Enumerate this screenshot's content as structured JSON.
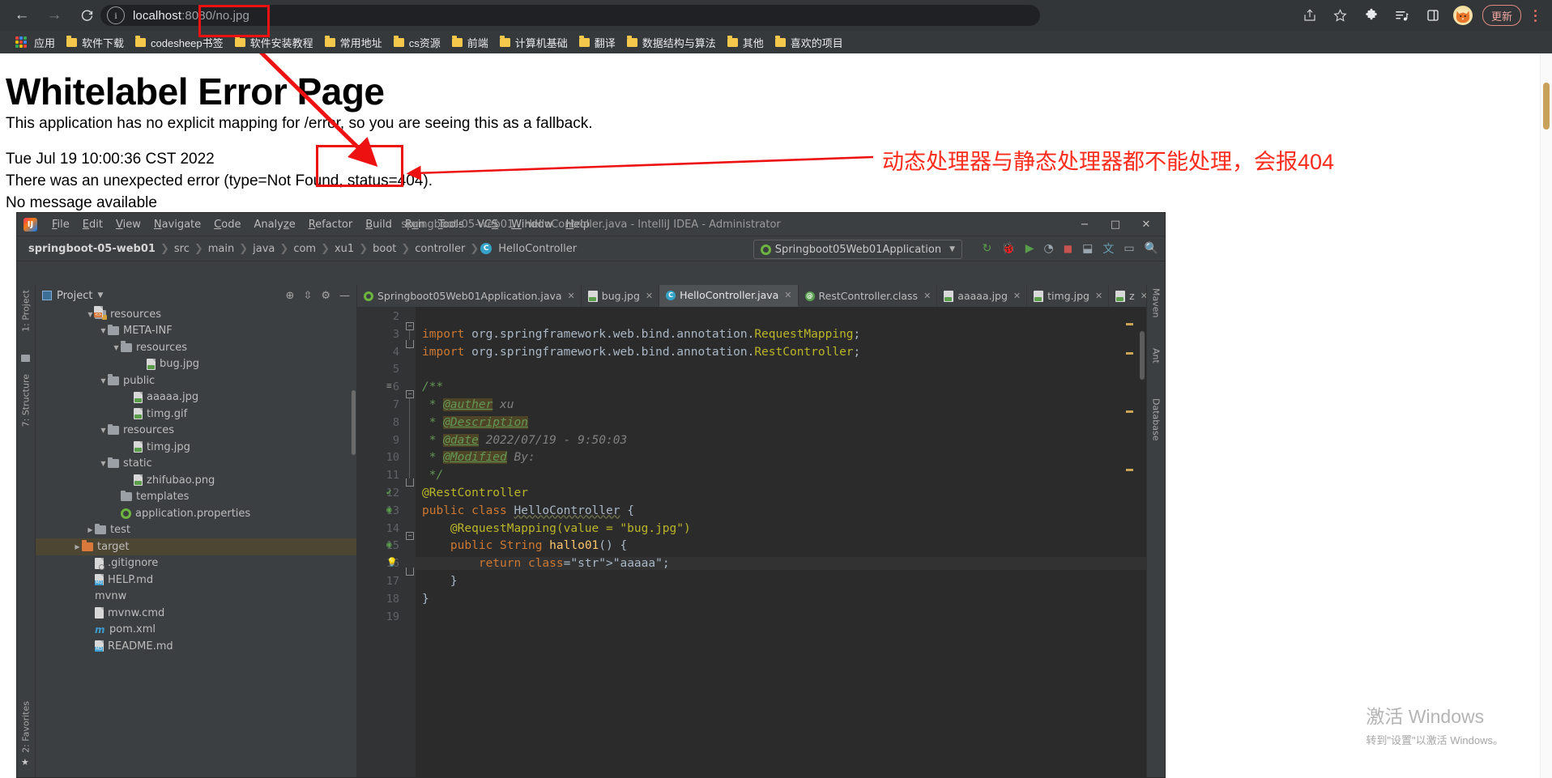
{
  "browser": {
    "nav": {
      "back": "←",
      "forward": "→",
      "reload": "⟳"
    },
    "omnibox": {
      "info_icon": "info-icon",
      "host": "localhost",
      "port": ":8080",
      "separator": "/",
      "path": "no.jpg"
    },
    "toolbar_icons": [
      "share-icon",
      "bookmark-star-icon",
      "extensions-puzzle-icon",
      "reading-list-icon",
      "side-panel-icon"
    ],
    "update_label": "更新",
    "bookmarks": [
      {
        "label": "应用",
        "icon": "apps-grid-icon"
      },
      {
        "label": "软件下载",
        "icon": "folder-icon"
      },
      {
        "label": "codesheep书签",
        "icon": "folder-icon"
      },
      {
        "label": "软件安装教程",
        "icon": "folder-icon"
      },
      {
        "label": "常用地址",
        "icon": "folder-icon"
      },
      {
        "label": "cs资源",
        "icon": "folder-icon"
      },
      {
        "label": "前端",
        "icon": "folder-icon"
      },
      {
        "label": "计算机基础",
        "icon": "folder-icon"
      },
      {
        "label": "翻译",
        "icon": "folder-icon"
      },
      {
        "label": "数据结构与算法",
        "icon": "folder-icon"
      },
      {
        "label": "其他",
        "icon": "folder-icon"
      },
      {
        "label": "喜欢的项目",
        "icon": "folder-icon"
      }
    ]
  },
  "error_page": {
    "title": "Whitelabel Error Page",
    "fallback": "This application has no explicit mapping for /error, so you are seeing this as a fallback.",
    "date": "Tue Jul 19 10:00:36 CST 2022",
    "error": "There was an unexpected error (type=Not Found, status=404).",
    "no_message": "No message available"
  },
  "annotation": {
    "text": "动态处理器与静态处理器都不能处理，会报404",
    "color": "#fd2b1c"
  },
  "ide": {
    "window_title": "springboot-05-web01 - HelloController.java - IntelliJ IDEA - Administrator",
    "menu": [
      "File",
      "Edit",
      "View",
      "Navigate",
      "Code",
      "Analyze",
      "Refactor",
      "Build",
      "Run",
      "Tools",
      "VCS",
      "Window",
      "Help"
    ],
    "window_controls": [
      "−",
      "□",
      "✕"
    ],
    "breadcrumbs": [
      "springboot-05-web01",
      "src",
      "main",
      "java",
      "com",
      "xu1",
      "boot",
      "controller",
      "HelloController"
    ],
    "run_config": "Springboot05Web01Application",
    "project_panel": {
      "title": "Project",
      "header_icons": [
        "locate-icon",
        "collapse-all-icon",
        "settings-gear-icon",
        "minimize-icon"
      ],
      "rail_left": [
        "1: Project",
        "7: Structure",
        "2: Favorites"
      ],
      "rail_right": [
        "Maven",
        "Ant",
        "Database"
      ],
      "tree": [
        {
          "label": "resources",
          "type": "folder-src",
          "depth": 3,
          "arrow": "▼"
        },
        {
          "label": "META-INF",
          "type": "folder",
          "depth": 4,
          "arrow": "▼"
        },
        {
          "label": "resources",
          "type": "folder",
          "depth": 5,
          "arrow": "▼"
        },
        {
          "label": "bug.jpg",
          "type": "image",
          "depth": 7,
          "arrow": ""
        },
        {
          "label": "public",
          "type": "folder",
          "depth": 4,
          "arrow": "▼"
        },
        {
          "label": "aaaaa.jpg",
          "type": "image",
          "depth": 6,
          "arrow": ""
        },
        {
          "label": "timg.gif",
          "type": "image",
          "depth": 6,
          "arrow": ""
        },
        {
          "label": "resources",
          "type": "folder",
          "depth": 4,
          "arrow": "▼"
        },
        {
          "label": "timg.jpg",
          "type": "image",
          "depth": 6,
          "arrow": ""
        },
        {
          "label": "static",
          "type": "folder",
          "depth": 4,
          "arrow": "▼"
        },
        {
          "label": "zhifubao.png",
          "type": "image",
          "depth": 6,
          "arrow": ""
        },
        {
          "label": "templates",
          "type": "folder",
          "depth": 5,
          "arrow": ""
        },
        {
          "label": "application.properties",
          "type": "spring",
          "depth": 5,
          "arrow": ""
        },
        {
          "label": "test",
          "type": "folder",
          "depth": 3,
          "arrow": "▶"
        },
        {
          "label": "target",
          "type": "folder-orange",
          "depth": 2,
          "arrow": "▶",
          "selected": true
        },
        {
          "label": ".gitignore",
          "type": "ignore",
          "depth": 3,
          "arrow": ""
        },
        {
          "label": "HELP.md",
          "type": "md",
          "depth": 3,
          "arrow": ""
        },
        {
          "label": "mvnw",
          "type": "code",
          "depth": 3,
          "arrow": ""
        },
        {
          "label": "mvnw.cmd",
          "type": "file",
          "depth": 3,
          "arrow": ""
        },
        {
          "label": "pom.xml",
          "type": "maven",
          "depth": 3,
          "arrow": ""
        },
        {
          "label": "README.md",
          "type": "md",
          "depth": 3,
          "arrow": ""
        }
      ]
    },
    "tabs": [
      {
        "label": "Springboot05Web01Application.java",
        "icon": "spring-icon",
        "active": false
      },
      {
        "label": "bug.jpg",
        "icon": "image-icon",
        "active": false
      },
      {
        "label": "HelloController.java",
        "icon": "class-icon",
        "active": true
      },
      {
        "label": "RestController.class",
        "icon": "class-green-icon",
        "active": false
      },
      {
        "label": "aaaaa.jpg",
        "icon": "image-icon",
        "active": false
      },
      {
        "label": "timg.jpg",
        "icon": "image-icon",
        "active": false
      },
      {
        "label": "z",
        "icon": "image-icon",
        "active": false
      }
    ],
    "code": {
      "line_numbers": [
        "2",
        "3",
        "4",
        "5",
        "6",
        "7",
        "8",
        "9",
        "10",
        "11",
        "12",
        "13",
        "14",
        "15",
        "16",
        "17",
        "18",
        "19"
      ],
      "lines": [
        "",
        "import org.springframework.web.bind.annotation.RequestMapping;",
        "import org.springframework.web.bind.annotation.RestController;",
        "",
        "/**",
        " * @auther xu",
        " * @Description",
        " * @date 2022/07/19 - 9:50:03",
        " * @Modified By:",
        " */",
        "@RestController",
        "public class HelloController {",
        "    @RequestMapping(value = \"bug.jpg\")",
        "    public String hallo01() {",
        "        return \"aaaaa\";",
        "    }",
        "}",
        ""
      ]
    }
  },
  "watermark": {
    "line1": "激活 Windows",
    "line2": "转到\"设置\"以激活 Windows。"
  }
}
